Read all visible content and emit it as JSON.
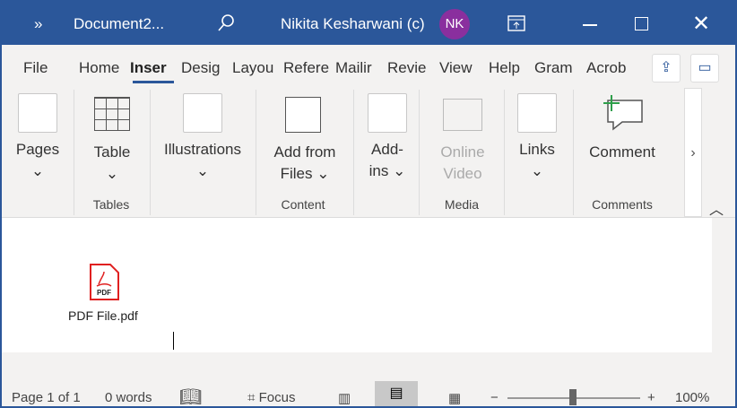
{
  "titlebar": {
    "quick_access": "»",
    "doc_name": "Document2...",
    "user": "Nikita Kesharwani (c)",
    "avatar": "NK",
    "avatar_color": "#8a2f9e"
  },
  "tabs": [
    "File",
    "Home",
    "Insert",
    "Design",
    "Layout",
    "References",
    "Mailings",
    "Review",
    "View",
    "Help",
    "Grammarly",
    "Acrobat"
  ],
  "tab_display": [
    "File",
    "Home",
    "Inser",
    "Desig",
    "Layou",
    "Refere",
    "Mailir",
    "Revie",
    "View",
    "Help",
    "Gram",
    "Acrob"
  ],
  "ribbon": {
    "pages": "Pages",
    "table": "Table",
    "illustrations": "Illustrations",
    "add_from_files_1": "Add from",
    "add_from_files_2": "Files",
    "addins_1": "Add-",
    "addins_2": "ins",
    "online_video_1": "Online",
    "online_video_2": "Video",
    "links": "Links",
    "comment": "Comment",
    "groups": {
      "tables": "Tables",
      "content": "Content",
      "media": "Media",
      "comments": "Comments"
    }
  },
  "document": {
    "attachment_name": "PDF File.pdf",
    "pdf_badge": "PDF"
  },
  "status": {
    "page": "Page 1 of 1",
    "words": "0 words",
    "focus": "Focus",
    "zoom_minus": "−",
    "zoom_plus": "+",
    "zoom": "100%",
    "zoom_value": 100
  }
}
